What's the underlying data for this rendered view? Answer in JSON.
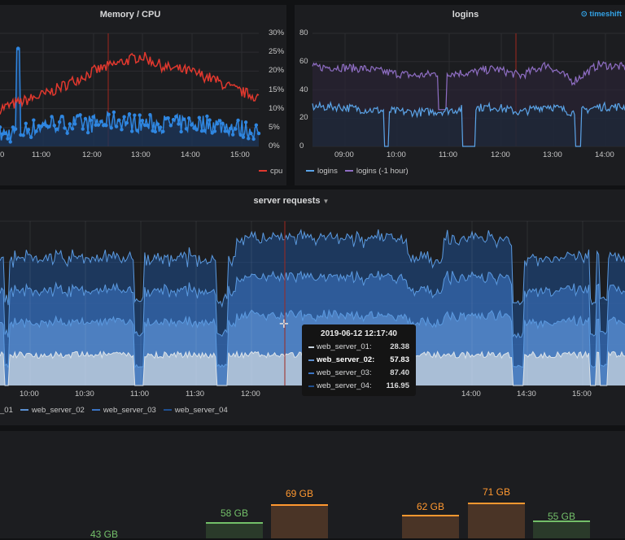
{
  "colors": {
    "cpu": "#e0382e",
    "memory": "#2f86e0",
    "logins": "#5ba4e8",
    "logins_shift": "#8f6ec4",
    "server_01": "#c8d3dd",
    "server_02": "#5b8fd0",
    "server_03": "#3a73c2",
    "server_04": "#1f4f8f",
    "green": "#73bf69",
    "orange": "#ff9830",
    "annotation": "#a0281e"
  },
  "memory_cpu": {
    "title": "Memory / CPU",
    "y_ticks": [
      "30%",
      "25%",
      "20%",
      "15%",
      "10%",
      "5%",
      "0%"
    ],
    "x_ticks": [
      "0",
      "11:00",
      "12:00",
      "13:00",
      "14:00",
      "15:00"
    ],
    "legend": [
      {
        "label": "cpu",
        "icon": "legend-line"
      }
    ],
    "chart_data": {
      "type": "line",
      "ylim": [
        0,
        30
      ],
      "unit": "%",
      "x": [
        "10:00",
        "10:30",
        "11:00",
        "11:30",
        "12:00",
        "12:30",
        "13:00",
        "13:30",
        "14:00",
        "14:30",
        "15:00",
        "15:20"
      ],
      "series": [
        {
          "name": "cpu",
          "values": [
            10,
            12,
            14,
            17,
            20,
            22,
            24,
            21,
            20,
            18,
            15,
            13
          ]
        },
        {
          "values": [
            3,
            4,
            6,
            6,
            6,
            7,
            6,
            6,
            6,
            6,
            5,
            4
          ]
        }
      ]
    }
  },
  "logins": {
    "title": "logins",
    "timeshift_label": "timeshift",
    "y_ticks": [
      "80",
      "60",
      "40",
      "20",
      "0"
    ],
    "x_ticks": [
      "09:00",
      "10:00",
      "11:00",
      "12:00",
      "13:00",
      "14:00"
    ],
    "legend": [
      {
        "label": "logins"
      },
      {
        "label": "logins (-1 hour)"
      }
    ],
    "chart_data": {
      "type": "line",
      "ylim": [
        0,
        80
      ],
      "x": [
        "08:40",
        "09:00",
        "09:30",
        "10:00",
        "10:30",
        "11:00",
        "11:30",
        "12:00",
        "12:30",
        "13:00",
        "13:30",
        "14:00",
        "14:30"
      ],
      "series": [
        {
          "name": "logins",
          "values": [
            28,
            28,
            26,
            25,
            24,
            25,
            27,
            28,
            24,
            29,
            24,
            28,
            28
          ]
        },
        {
          "name": "logins (-1 hour)",
          "values": [
            56,
            56,
            55,
            52,
            50,
            52,
            52,
            55,
            50,
            58,
            46,
            58,
            56
          ]
        }
      ]
    }
  },
  "server_requests": {
    "title": "server requests",
    "x_ticks": [
      "10:00",
      "10:30",
      "11:00",
      "11:30",
      "12:00",
      "14:00",
      "14:30",
      "15:00"
    ],
    "legend": [
      {
        "label": "_01"
      },
      {
        "label": "web_server_02"
      },
      {
        "label": "web_server_03"
      },
      {
        "label": "web_server_04"
      }
    ],
    "tooltip": {
      "time": "2019-06-12 12:17:40",
      "rows": [
        {
          "name": "web_server_01:",
          "value": "28.38"
        },
        {
          "name": "web_server_02:",
          "value": "57.83"
        },
        {
          "name": "web_server_03:",
          "value": "87.40"
        },
        {
          "name": "web_server_04:",
          "value": "116.95"
        }
      ]
    },
    "chart_data": {
      "type": "area",
      "stacked": true,
      "series": [
        {
          "name": "web_server_01",
          "values": [
            28
          ]
        },
        {
          "name": "web_server_02",
          "values": [
            57.83
          ]
        },
        {
          "name": "web_server_03",
          "values": [
            87.4
          ]
        },
        {
          "name": "web_server_04",
          "values": [
            116.95
          ]
        }
      ]
    }
  },
  "disk": {
    "chart_data": {
      "type": "bar",
      "values": [
        43,
        58,
        69,
        62,
        71,
        55
      ],
      "unit": "GB"
    },
    "labels": [
      "43 GB",
      "58 GB",
      "69 GB",
      "62 GB",
      "71 GB",
      "55 GB"
    ]
  }
}
